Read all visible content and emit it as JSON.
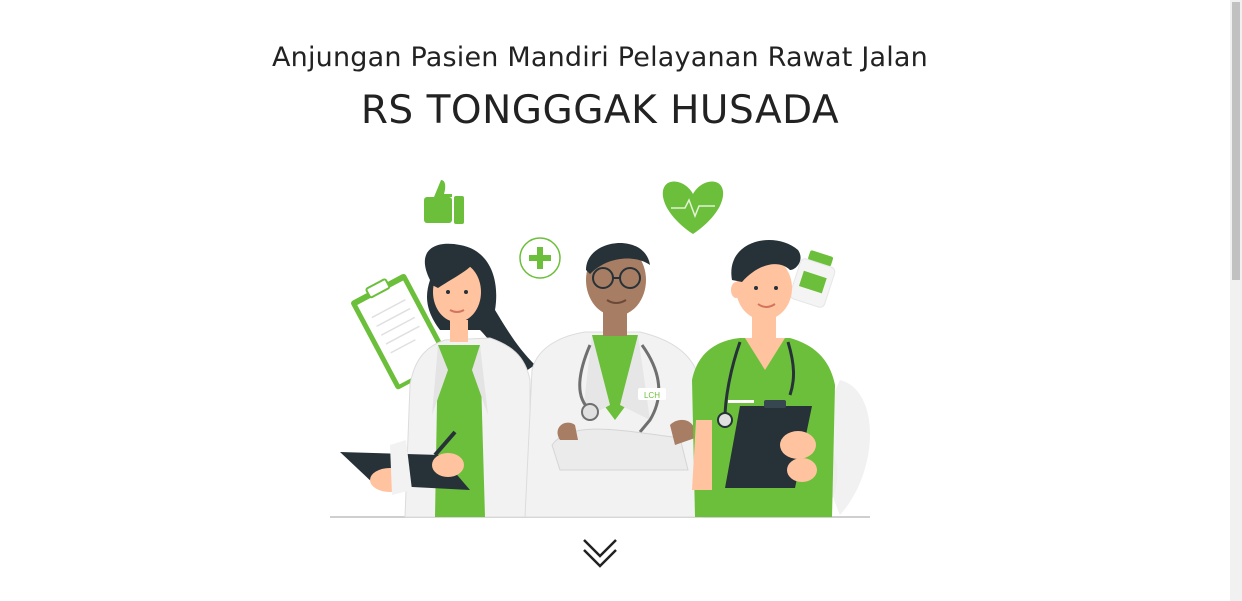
{
  "header": {
    "subtitle": "Anjungan Pasien Mandiri Pelayanan Rawat Jalan",
    "title": "RS TONGGGAK HUSADA"
  },
  "hero": {
    "icons": [
      "thumbs-up-icon",
      "plus-circle-icon",
      "heart-pulse-icon",
      "medicine-bottle-icon",
      "clipboard-icon",
      "stethoscope-icon"
    ],
    "figures": [
      "female-doctor",
      "male-doctor",
      "male-nurse"
    ],
    "doctor_badge": "LCH"
  },
  "scroll": {
    "icon": "chevrons-down-icon"
  },
  "colors": {
    "accent_green": "#6cbf3a",
    "text": "#222222",
    "dark": "#263238",
    "skin_light": "#ffc3a0",
    "skin_dark": "#a77d63"
  }
}
